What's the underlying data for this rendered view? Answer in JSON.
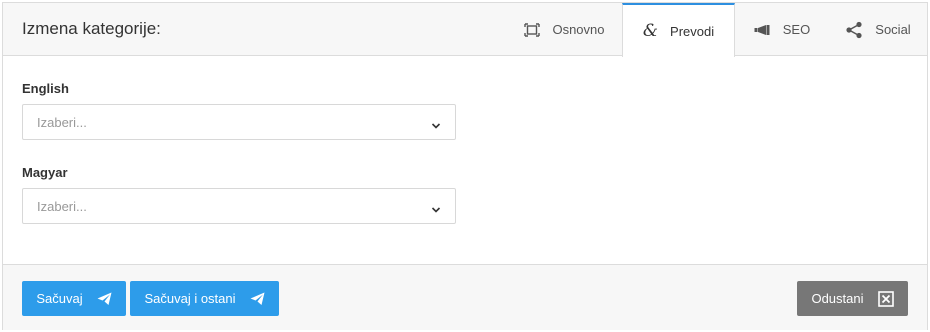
{
  "header": {
    "title": "Izmena kategorije:"
  },
  "tabs": [
    {
      "label": "Osnovno",
      "icon": "frame-icon",
      "active": false
    },
    {
      "label": "Prevodi",
      "icon": "ampersand-icon",
      "active": true
    },
    {
      "label": "SEO",
      "icon": "megaphone-icon",
      "active": false
    },
    {
      "label": "Social",
      "icon": "share-icon",
      "active": false
    }
  ],
  "fields": [
    {
      "label": "English",
      "placeholder": "Izaberi..."
    },
    {
      "label": "Magyar",
      "placeholder": "Izaberi..."
    }
  ],
  "footer": {
    "save_label": "Sačuvaj",
    "save_stay_label": "Sačuvaj i ostani",
    "cancel_label": "Odustani"
  },
  "colors": {
    "primary": "#2d9cea",
    "active_tab_border": "#2d8fe0",
    "cancel": "#777777",
    "panel_bg": "#f7f7f7"
  }
}
